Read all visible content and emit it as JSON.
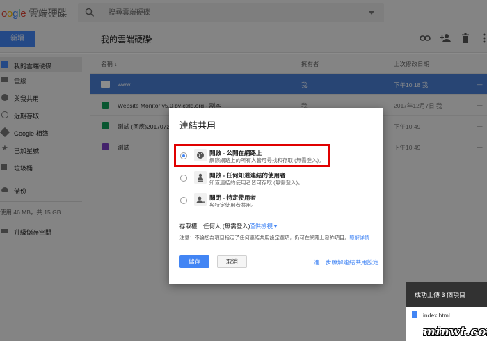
{
  "header": {
    "logo_letters": [
      "o",
      "o",
      "g",
      "l",
      "e"
    ],
    "product": "雲端硬碟",
    "search_placeholder": "搜尋雲端硬碟"
  },
  "toolbar": {
    "new_label": "新增",
    "folder_title": "我的雲端硬碟"
  },
  "sidebar": {
    "items": [
      {
        "label": "我的雲端硬碟",
        "icon": "drive-icon"
      },
      {
        "label": "電腦",
        "icon": "computer-icon"
      },
      {
        "label": "與我共用",
        "icon": "shared-icon"
      },
      {
        "label": "近期存取",
        "icon": "clock-icon"
      },
      {
        "label": "Google 相簿",
        "icon": "photos-icon"
      },
      {
        "label": "已加星號",
        "icon": "star-icon"
      },
      {
        "label": "垃圾桶",
        "icon": "trash-icon"
      },
      {
        "label": "備份",
        "icon": "cloud-icon"
      }
    ],
    "storage_text": "使用 46 MB，共 15 GB",
    "upgrade_label": "升級儲存空間"
  },
  "list": {
    "col_name": "名稱",
    "col_owner": "擁有者",
    "col_modified": "上次修改日期",
    "rows": [
      {
        "name": "www",
        "owner": "我",
        "modified": "下午10:18 我",
        "dash": "—"
      },
      {
        "name": "Website Monitor v5.0 by ctrlq.org - 副本",
        "owner": "我",
        "modified": "2017年12月7日 我",
        "dash": "—"
      },
      {
        "name": "測試 (回應)20170725",
        "owner": "",
        "modified": "下午10:49",
        "dash": "—"
      },
      {
        "name": "測試",
        "owner": "",
        "modified": "下午10:49",
        "dash": "—"
      }
    ]
  },
  "toast": {
    "title": "成功上傳 3 個項目",
    "file": "index.html"
  },
  "dialog": {
    "title": "連結共用",
    "options": [
      {
        "title": "開啟 - 公開在網路上",
        "desc": "網際網路上的所有人皆可尋找和存取 (無需登入)。",
        "selected": true
      },
      {
        "title": "開啟 - 任何知道連結的使用者",
        "desc": "知道連結的使用者皆可存取 (無需登入)。",
        "selected": false
      },
      {
        "title": "關閉 - 特定使用者",
        "desc": "與特定使用者共用。",
        "selected": false
      }
    ],
    "access_label": "存取權　任何人 (無需登入)",
    "access_value": "僅供檢視",
    "note": "注意：不論您為項目指定了任何連結共用設定選項，仍可在網路上發佈項目。",
    "note_link": "瞭解詳情",
    "save_label": "儲存",
    "cancel_label": "取消",
    "more_link": "進一步瞭解連結共用設定"
  },
  "watermark": "minwt.com",
  "colors": {
    "accent": "#4285f4",
    "selected_row": "#4a7ed3",
    "highlight_box": "#e00000"
  }
}
